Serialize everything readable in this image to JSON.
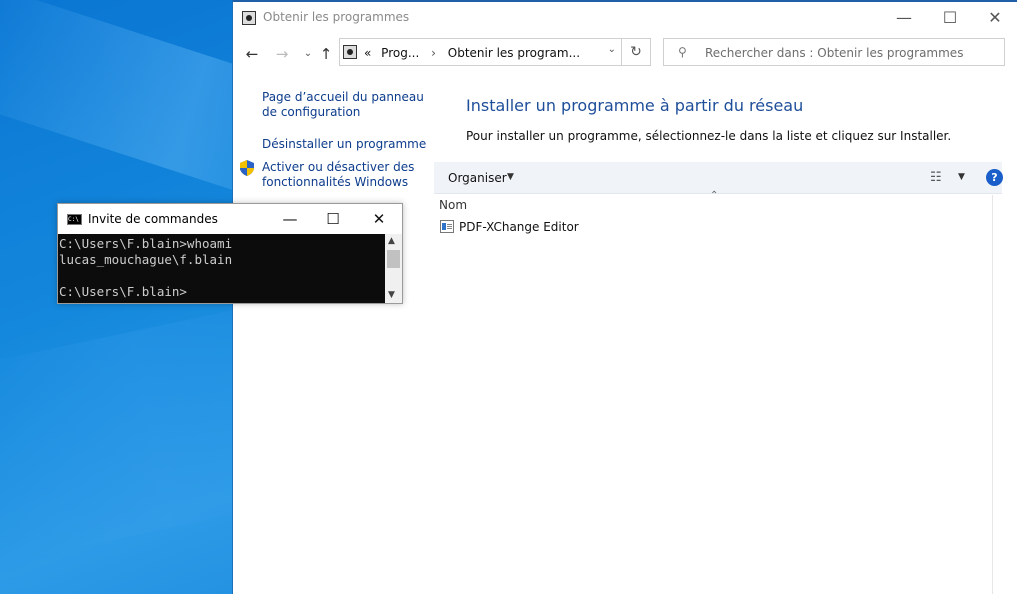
{
  "explorer": {
    "title": "Obtenir les programmes",
    "window_controls": {
      "minimize": "—",
      "maximize": "☐",
      "close": "✕"
    },
    "nav": {
      "back": "←",
      "forward": "→",
      "history": "⌄",
      "up": "↑"
    },
    "address": {
      "prefix": "«",
      "crumbs": [
        "Prog...",
        "Obtenir les program..."
      ],
      "separator": "›",
      "dropdown": "⌄",
      "refresh": "↻"
    },
    "search": {
      "placeholder": "Rechercher dans : Obtenir les programmes"
    },
    "sidebar": {
      "links": [
        "Page d’accueil du panneau de configuration",
        "Désinstaller un programme",
        "Activer ou désactiver des fonctionnalités Windows"
      ]
    },
    "main": {
      "title": "Installer un programme à partir du réseau",
      "description": "Pour installer un programme, sélectionnez-le dans la liste et cliquez sur Installer."
    },
    "toolbar": {
      "organise": "Organiser",
      "help": "?"
    },
    "list": {
      "column_header": "Nom",
      "items": [
        "PDF-XChange Editor"
      ]
    }
  },
  "cmd": {
    "title": "Invite de commandes",
    "icon_text": "C:\\",
    "window_controls": {
      "minimize": "—",
      "maximize": "☐",
      "close": "✕"
    },
    "lines": [
      "C:\\Users\\F.blain>whoami",
      "lucas_mouchague\\f.blain",
      "C:\\Users\\F.blain>"
    ]
  },
  "colors": {
    "desktop": "#0a76d3",
    "link": "#0d3c8c",
    "heading": "#1e4e9a",
    "console_bg": "#0c0c0c"
  }
}
